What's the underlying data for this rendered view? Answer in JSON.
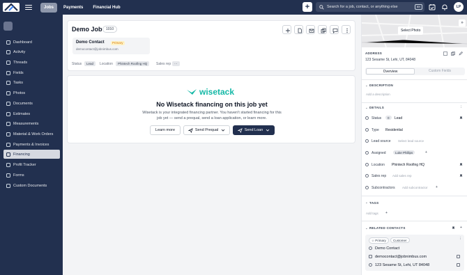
{
  "topbar": {
    "tabs": [
      {
        "label": "Jobs",
        "active": true
      },
      {
        "label": "Payments",
        "active": false
      },
      {
        "label": "Financial Hub",
        "active": false
      }
    ],
    "search_placeholder": "Search for a job, contact, or anything else",
    "search_shortcut": "⌘K",
    "avatar_initials": "LP"
  },
  "sidebar": {
    "items": [
      {
        "label": "Dashboard",
        "active": false
      },
      {
        "label": "Activity",
        "active": false
      },
      {
        "label": "Threads",
        "active": false
      },
      {
        "label": "Fields",
        "active": false
      },
      {
        "label": "Tasks",
        "active": false
      },
      {
        "label": "Photos",
        "active": false
      },
      {
        "label": "Documents",
        "active": false
      },
      {
        "label": "Estimates",
        "active": false
      },
      {
        "label": "Measurements",
        "active": false
      },
      {
        "label": "Material & Work Orders",
        "active": false
      },
      {
        "label": "Payments & Invoices",
        "active": false
      },
      {
        "label": "Financing",
        "active": true
      },
      {
        "label": "Profit Tracker",
        "active": false
      },
      {
        "label": "Forms",
        "active": false
      },
      {
        "label": "Custom Documents",
        "active": false
      }
    ]
  },
  "job": {
    "title": "Demo Job",
    "number": "1010",
    "contact_name": "Demo Contact",
    "contact_badge": "Primary",
    "contact_email": "democontact@jobnimbus.com",
    "status_label": "Status",
    "status_value": "Lead",
    "location_label": "Location",
    "location_value": "Phintech Roofing HQ",
    "salesrep_label": "Sales rep",
    "salesrep_more": "···"
  },
  "financing": {
    "brand": "wisetack",
    "heading": "No Wisetack financing on this job yet",
    "body": "Wisetack is your integrated financing partner. You haven't started financing for this job yet — send a prequal, send a loan application, or learn more.",
    "learn_more": "Learn more",
    "send_prequal": "Send Prequal",
    "send_loan": "Send Loan"
  },
  "panel": {
    "select_photo": "Select Photo",
    "address_label": "ADDRESS",
    "address_value": "123 Sesame St, Lehi, UT, 84048",
    "tab_overview": "Overview",
    "tab_custom": "Custom Fields",
    "description_label": "DESCRIPTION",
    "description_add": "Add a description",
    "details_label": "DETAILS",
    "status_label": "Status",
    "status_count": "0",
    "status_value": "Lead",
    "type_label": "Type",
    "type_value": "Residential",
    "leadsource_label": "Lead source",
    "leadsource_placeholder": "Select lead source",
    "assigned_label": "Assigned",
    "assigned_value": "Luke Phillips",
    "location_label": "Location",
    "location_value": "Phintech Roofing HQ",
    "salesrep_label": "Sales rep",
    "salesrep_placeholder": "Add sales rep",
    "subcontractors_label": "Subcontractors",
    "subcontractors_placeholder": "Add subcontractor",
    "tags_label": "TAGS",
    "tags_add": "Add tags",
    "related_label": "RELATED CONTACTS",
    "related_tag1": "Primary",
    "related_tag2": "Customer",
    "related_name": "Demo Contact",
    "related_email": "democontact@jobnimbus.com",
    "related_address": "123 Sesame St, Lehi, UT 84048"
  }
}
